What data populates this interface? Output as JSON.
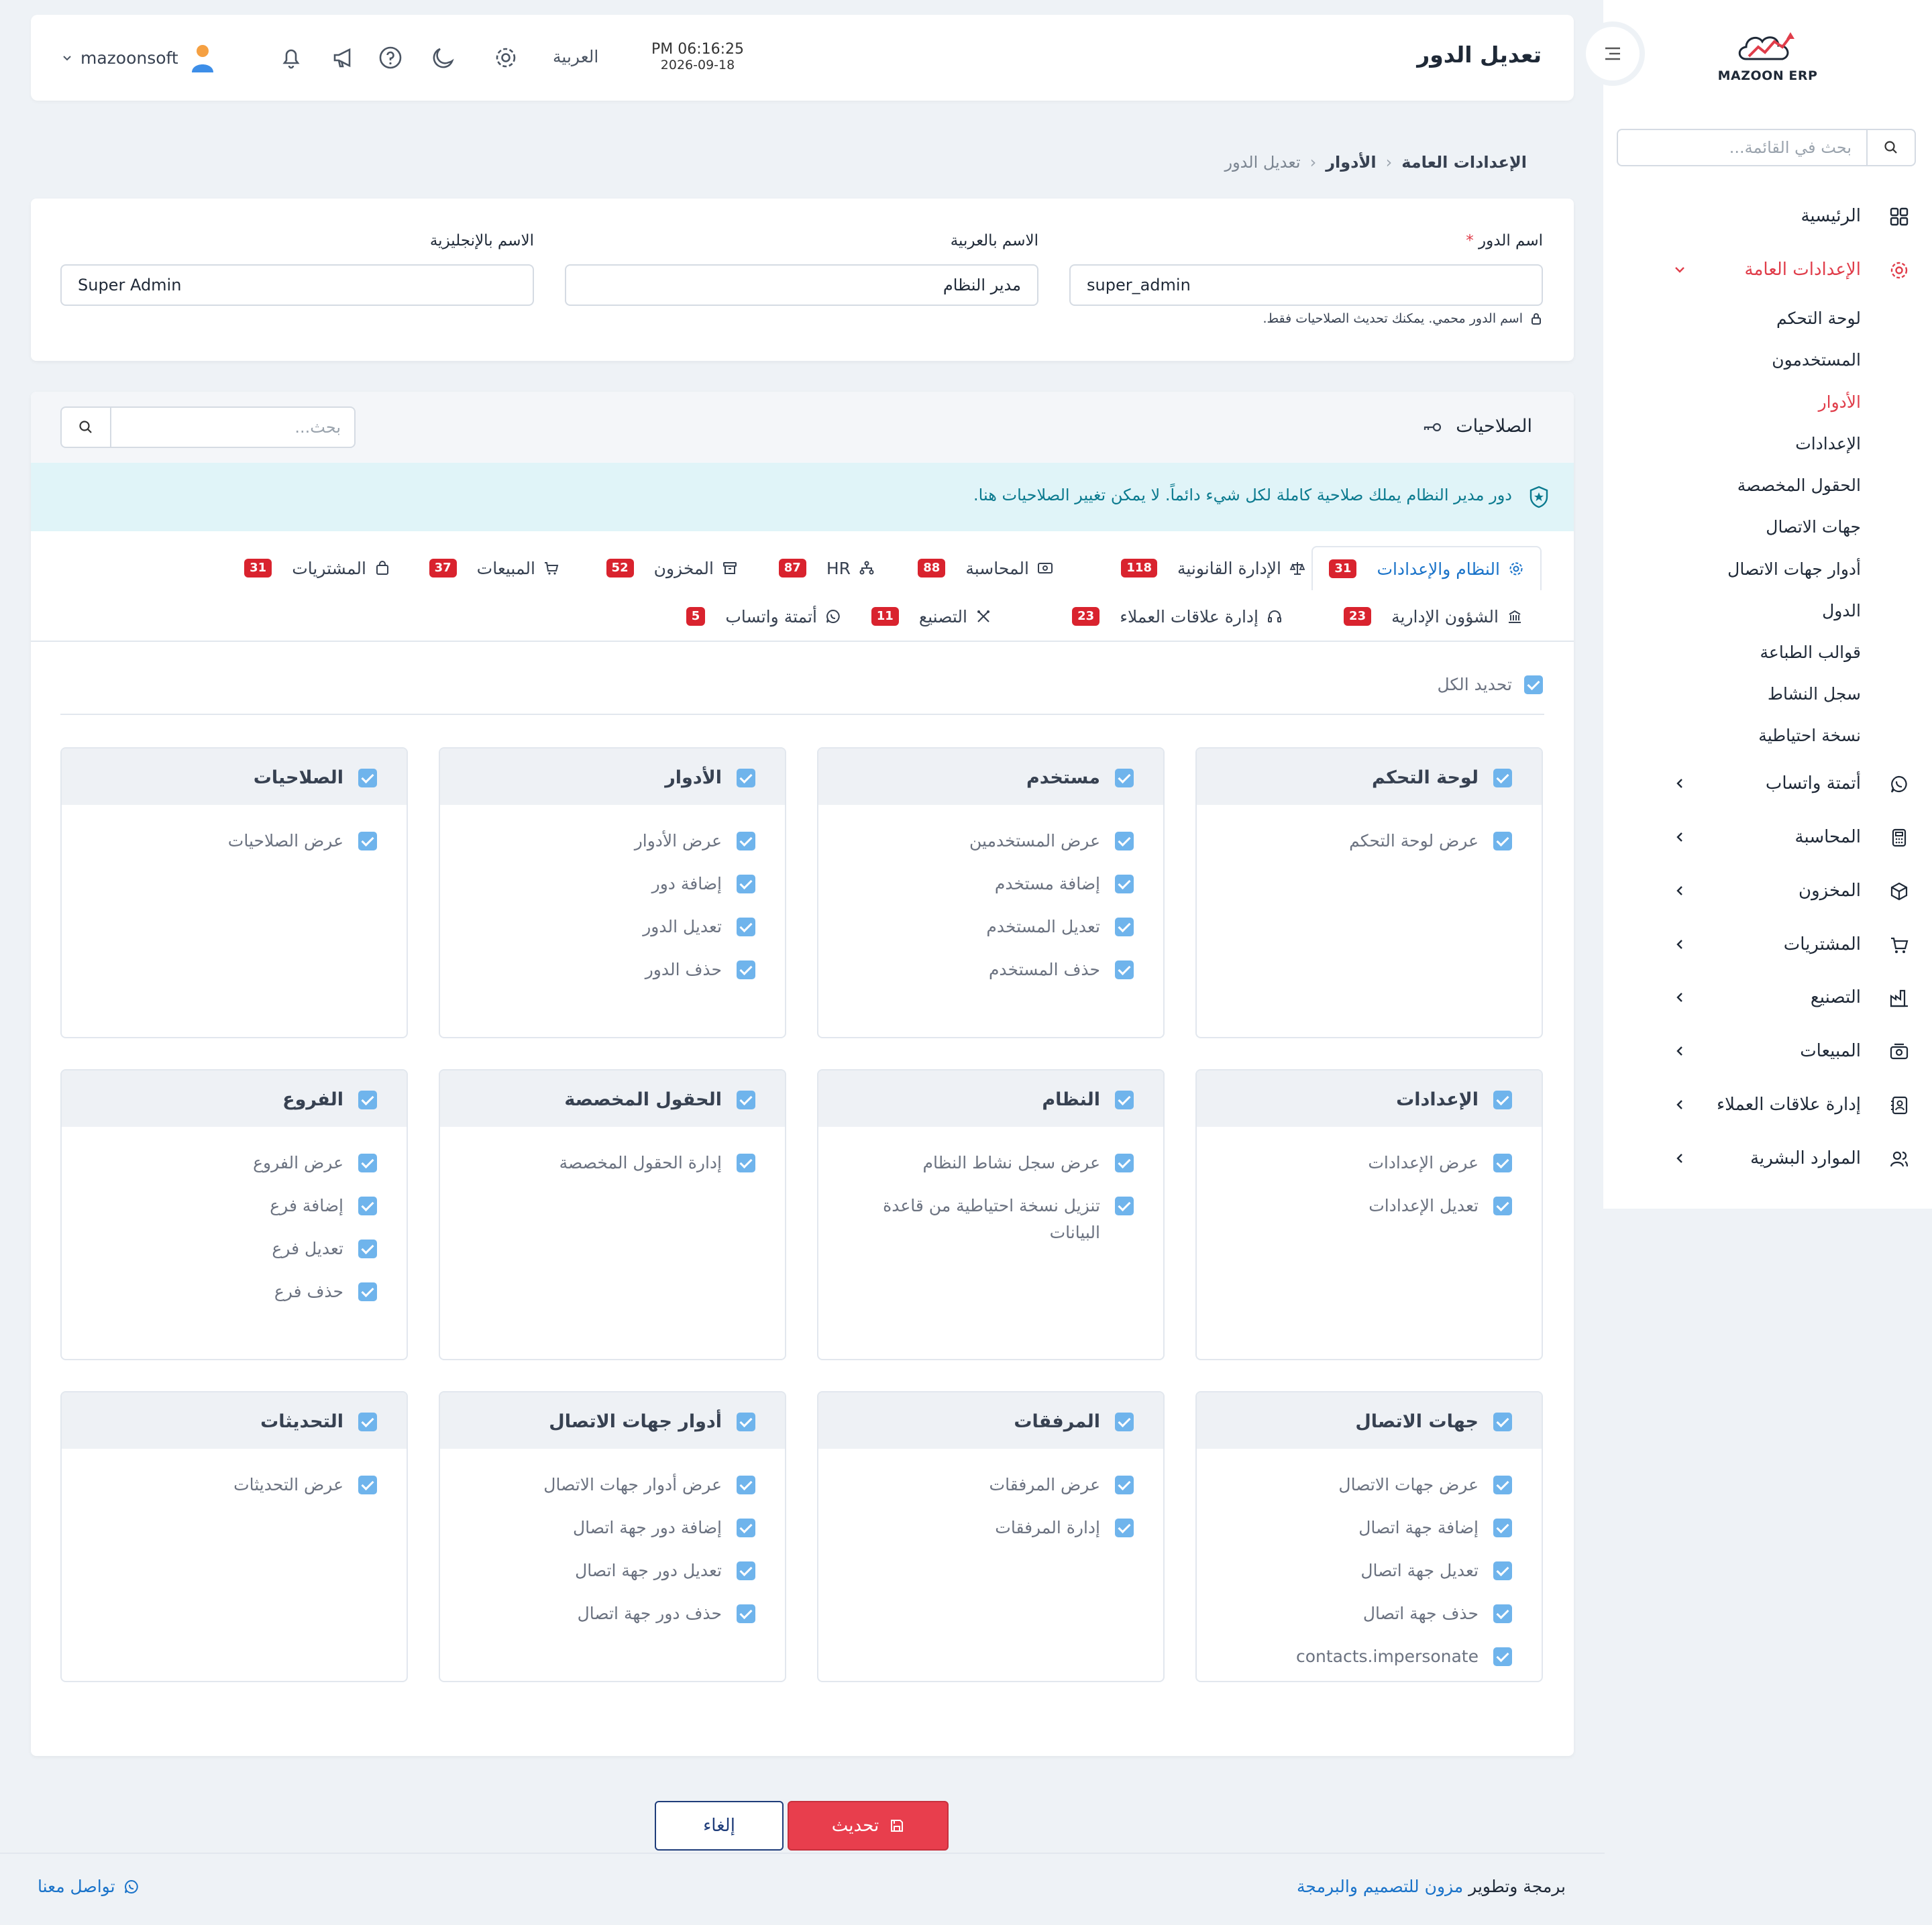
{
  "app": {
    "brand": "MAZOON ERP"
  },
  "sidebar": {
    "search_placeholder": "بحث في القائمة...",
    "home": "الرئيسية",
    "general_settings": "الإعدادات العامة",
    "sub": [
      "لوحة التحكم",
      "المستخدمون",
      "الأدوار",
      "الإعدادات",
      "الحقول المخصصة",
      "جهات الاتصال",
      "أدوار جهات الاتصال",
      "الدول",
      "قوالب الطباعة",
      "سجل النشاط",
      "نسخة احتياطية"
    ],
    "modules": [
      "أتمتة واتساب",
      "المحاسبة",
      "المخزون",
      "المشتريات",
      "التصنيع",
      "المبيعات",
      "إدارة علاقات العملاء",
      "الموارد البشرية"
    ]
  },
  "header": {
    "title": "تعديل الدور",
    "time": "PM 06:16:25",
    "date": "2026-09-18",
    "language": "العربية",
    "username": "mazoonsoft"
  },
  "breadcrumb": {
    "root": "الإعدادات العامة",
    "parent": "الأدوار",
    "current": "تعديل الدور"
  },
  "role_form": {
    "role_name_label": "اسم الدور",
    "required_mark": "*",
    "role_name_value": "super_admin",
    "role_name_hint": "اسم الدور محمي. يمكنك تحديث الصلاحيات فقط.",
    "arabic_name_label": "الاسم بالعربية",
    "arabic_name_value": "مدير النظام",
    "english_name_label": "الاسم بالإنجليزية",
    "english_name_value": "Super Admin"
  },
  "permissions": {
    "title": "الصلاحيات",
    "search_placeholder": "بحث...",
    "notice": "دور مدير النظام يملك صلاحية كاملة لكل شيء دائماً. لا يمكن تغيير الصلاحيات هنا.",
    "select_all": "تحديد الكل",
    "tabs_row1": [
      {
        "label": "النظام والإعدادات",
        "count": "31"
      },
      {
        "label": "الإدارة القانونية",
        "count": "118"
      },
      {
        "label": "المحاسبة",
        "count": "88"
      },
      {
        "label": "HR",
        "count": "87"
      },
      {
        "label": "المخزون",
        "count": "52"
      },
      {
        "label": "المبيعات",
        "count": "37"
      },
      {
        "label": "المشتريات",
        "count": "31"
      }
    ],
    "tabs_row2": [
      {
        "label": "الشؤون الإدارية",
        "count": "23"
      },
      {
        "label": "إدارة علاقات العملاء",
        "count": "23"
      },
      {
        "label": "التصنيع",
        "count": "11"
      },
      {
        "label": "أتمتة واتساب",
        "count": "5"
      }
    ],
    "groups": [
      {
        "title": "لوحة التحكم",
        "items": [
          "عرض لوحة التحكم"
        ]
      },
      {
        "title": "مستخدم",
        "items": [
          "عرض المستخدمين",
          "إضافة مستخدم",
          "تعديل المستخدم",
          "حذف المستخدم"
        ]
      },
      {
        "title": "الأدوار",
        "items": [
          "عرض الأدوار",
          "إضافة دور",
          "تعديل الدور",
          "حذف الدور"
        ]
      },
      {
        "title": "الصلاحيات",
        "items": [
          "عرض الصلاحيات"
        ]
      },
      {
        "title": "الإعدادات",
        "items": [
          "عرض الإعدادات",
          "تعديل الإعدادات"
        ]
      },
      {
        "title": "النظام",
        "items": [
          "عرض سجل نشاط النظام",
          "تنزيل نسخة احتياطية من قاعدة البيانات"
        ]
      },
      {
        "title": "الحقول المخصصة",
        "items": [
          "إدارة الحقول المخصصة"
        ]
      },
      {
        "title": "الفروع",
        "items": [
          "عرض الفروع",
          "إضافة فرع",
          "تعديل فرع",
          "حذف فرع"
        ]
      },
      {
        "title": "جهات الاتصال",
        "items": [
          "عرض جهات الاتصال",
          "إضافة جهة اتصال",
          "تعديل جهة اتصال",
          "حذف جهة اتصال",
          "contacts.impersonate"
        ]
      },
      {
        "title": "المرفقات",
        "items": [
          "عرض المرفقات",
          "إدارة المرفقات"
        ]
      },
      {
        "title": "أدوار جهات الاتصال",
        "items": [
          "عرض أدوار جهات الاتصال",
          "إضافة دور جهة اتصال",
          "تعديل دور جهة اتصال",
          "حذف دور جهة اتصال"
        ]
      },
      {
        "title": "التحديثات",
        "items": [
          "عرض التحديثات"
        ]
      }
    ]
  },
  "actions": {
    "update": "تحديث",
    "cancel": "إلغاء"
  },
  "footer": {
    "prefix": "برمجة وتطوير",
    "company": "مزون للتصميم والبرمجة",
    "contact": "تواصل معنا"
  },
  "colors": {
    "accent_red": "#e03d4a",
    "link_blue": "#1a73c9",
    "badge_red": "#d9232e",
    "checkbox_blue": "#6fb4ec"
  }
}
